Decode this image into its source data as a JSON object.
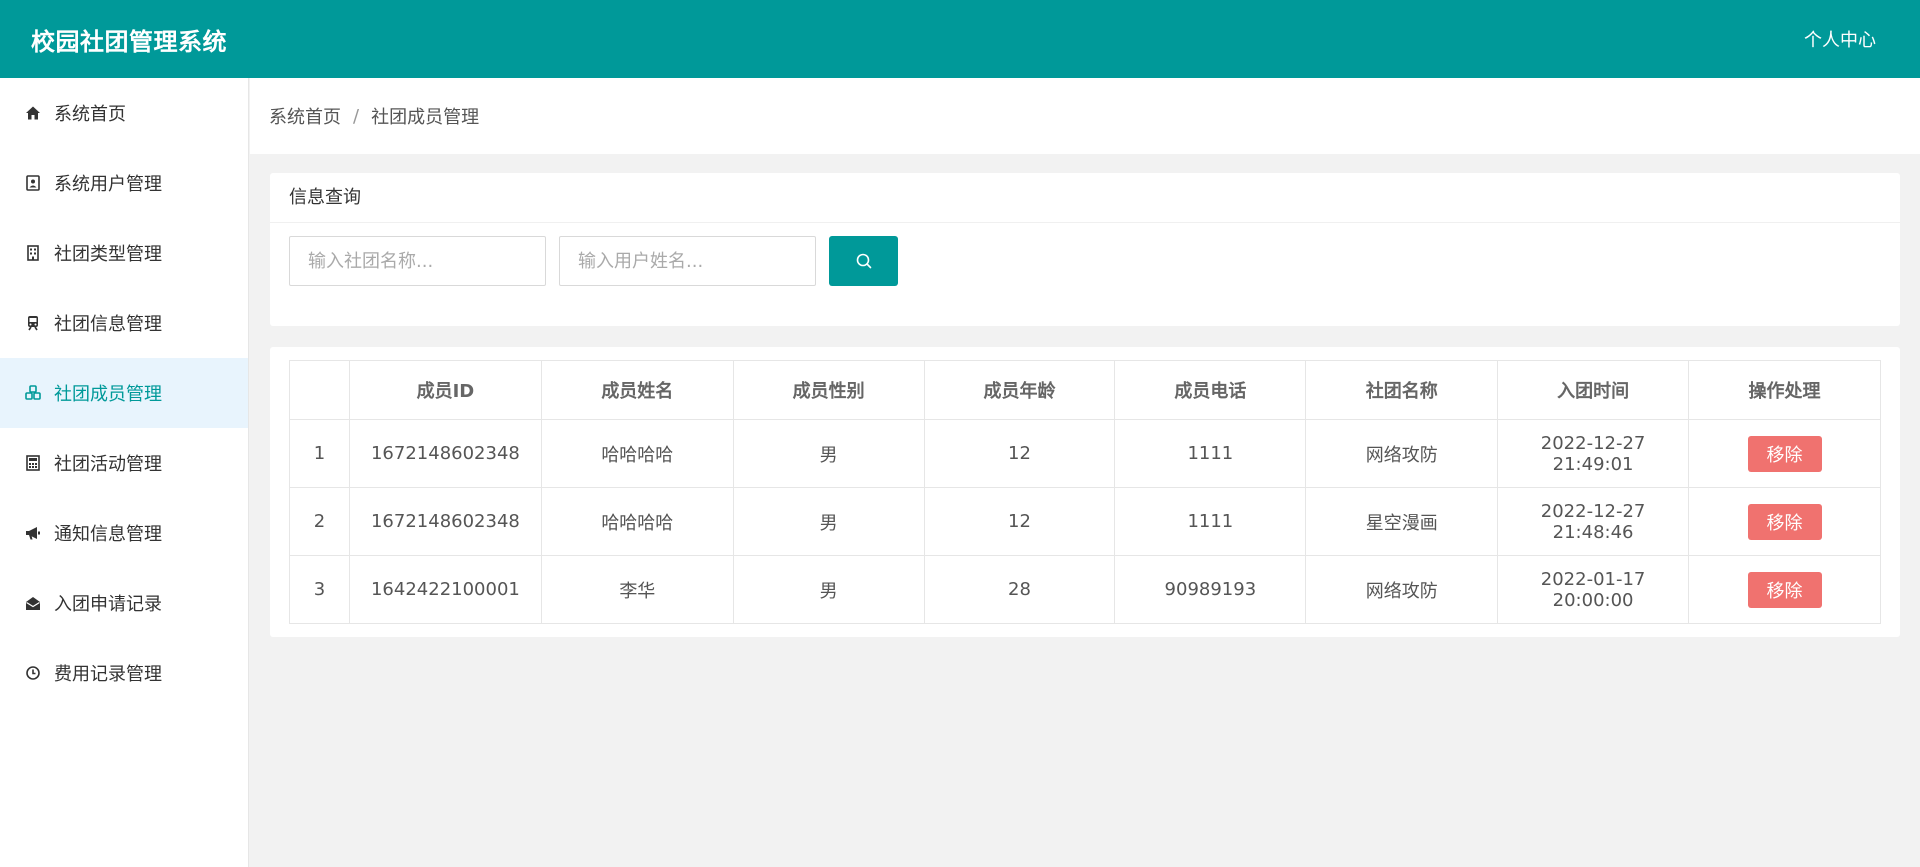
{
  "header": {
    "title": "校园社团管理系统",
    "user_center": "个人中心"
  },
  "sidebar": {
    "items": [
      {
        "label": "系统首页",
        "icon": "home-icon"
      },
      {
        "label": "系统用户管理",
        "icon": "contact-card-icon"
      },
      {
        "label": "社团类型管理",
        "icon": "building-icon"
      },
      {
        "label": "社团信息管理",
        "icon": "train-icon"
      },
      {
        "label": "社团成员管理",
        "icon": "cubes-icon",
        "active": true
      },
      {
        "label": "社团活动管理",
        "icon": "calculator-icon"
      },
      {
        "label": "通知信息管理",
        "icon": "bullhorn-icon"
      },
      {
        "label": "入团申请记录",
        "icon": "envelope-open-icon"
      },
      {
        "label": "费用记录管理",
        "icon": "clock-icon"
      }
    ]
  },
  "breadcrumb": {
    "home": "系统首页",
    "separator": "/",
    "current": "社团成员管理"
  },
  "query": {
    "title": "信息查询",
    "club_name_placeholder": "输入社团名称...",
    "user_name_placeholder": "输入用户姓名...",
    "search_icon": "search-icon"
  },
  "table": {
    "headers": [
      "",
      "成员ID",
      "成员姓名",
      "成员性别",
      "成员年龄",
      "成员电话",
      "社团名称",
      "入团时间",
      "操作处理"
    ],
    "rows": [
      {
        "index": "1",
        "id": "1672148602348",
        "name": "哈哈哈哈",
        "gender": "男",
        "age": "12",
        "phone": "1111",
        "club": "网络攻防",
        "join_time": "2022-12-27 21:49:01",
        "action": "移除"
      },
      {
        "index": "2",
        "id": "1672148602348",
        "name": "哈哈哈哈",
        "gender": "男",
        "age": "12",
        "phone": "1111",
        "club": "星空漫画",
        "join_time": "2022-12-27 21:48:46",
        "action": "移除"
      },
      {
        "index": "3",
        "id": "1642422100001",
        "name": "李华",
        "gender": "男",
        "age": "28",
        "phone": "90989193",
        "club": "网络攻防",
        "join_time": "2022-01-17 20:00:00",
        "action": "移除"
      }
    ]
  },
  "colors": {
    "primary": "#009999",
    "danger": "#f0726f",
    "active_bg": "#e8f4fd"
  }
}
